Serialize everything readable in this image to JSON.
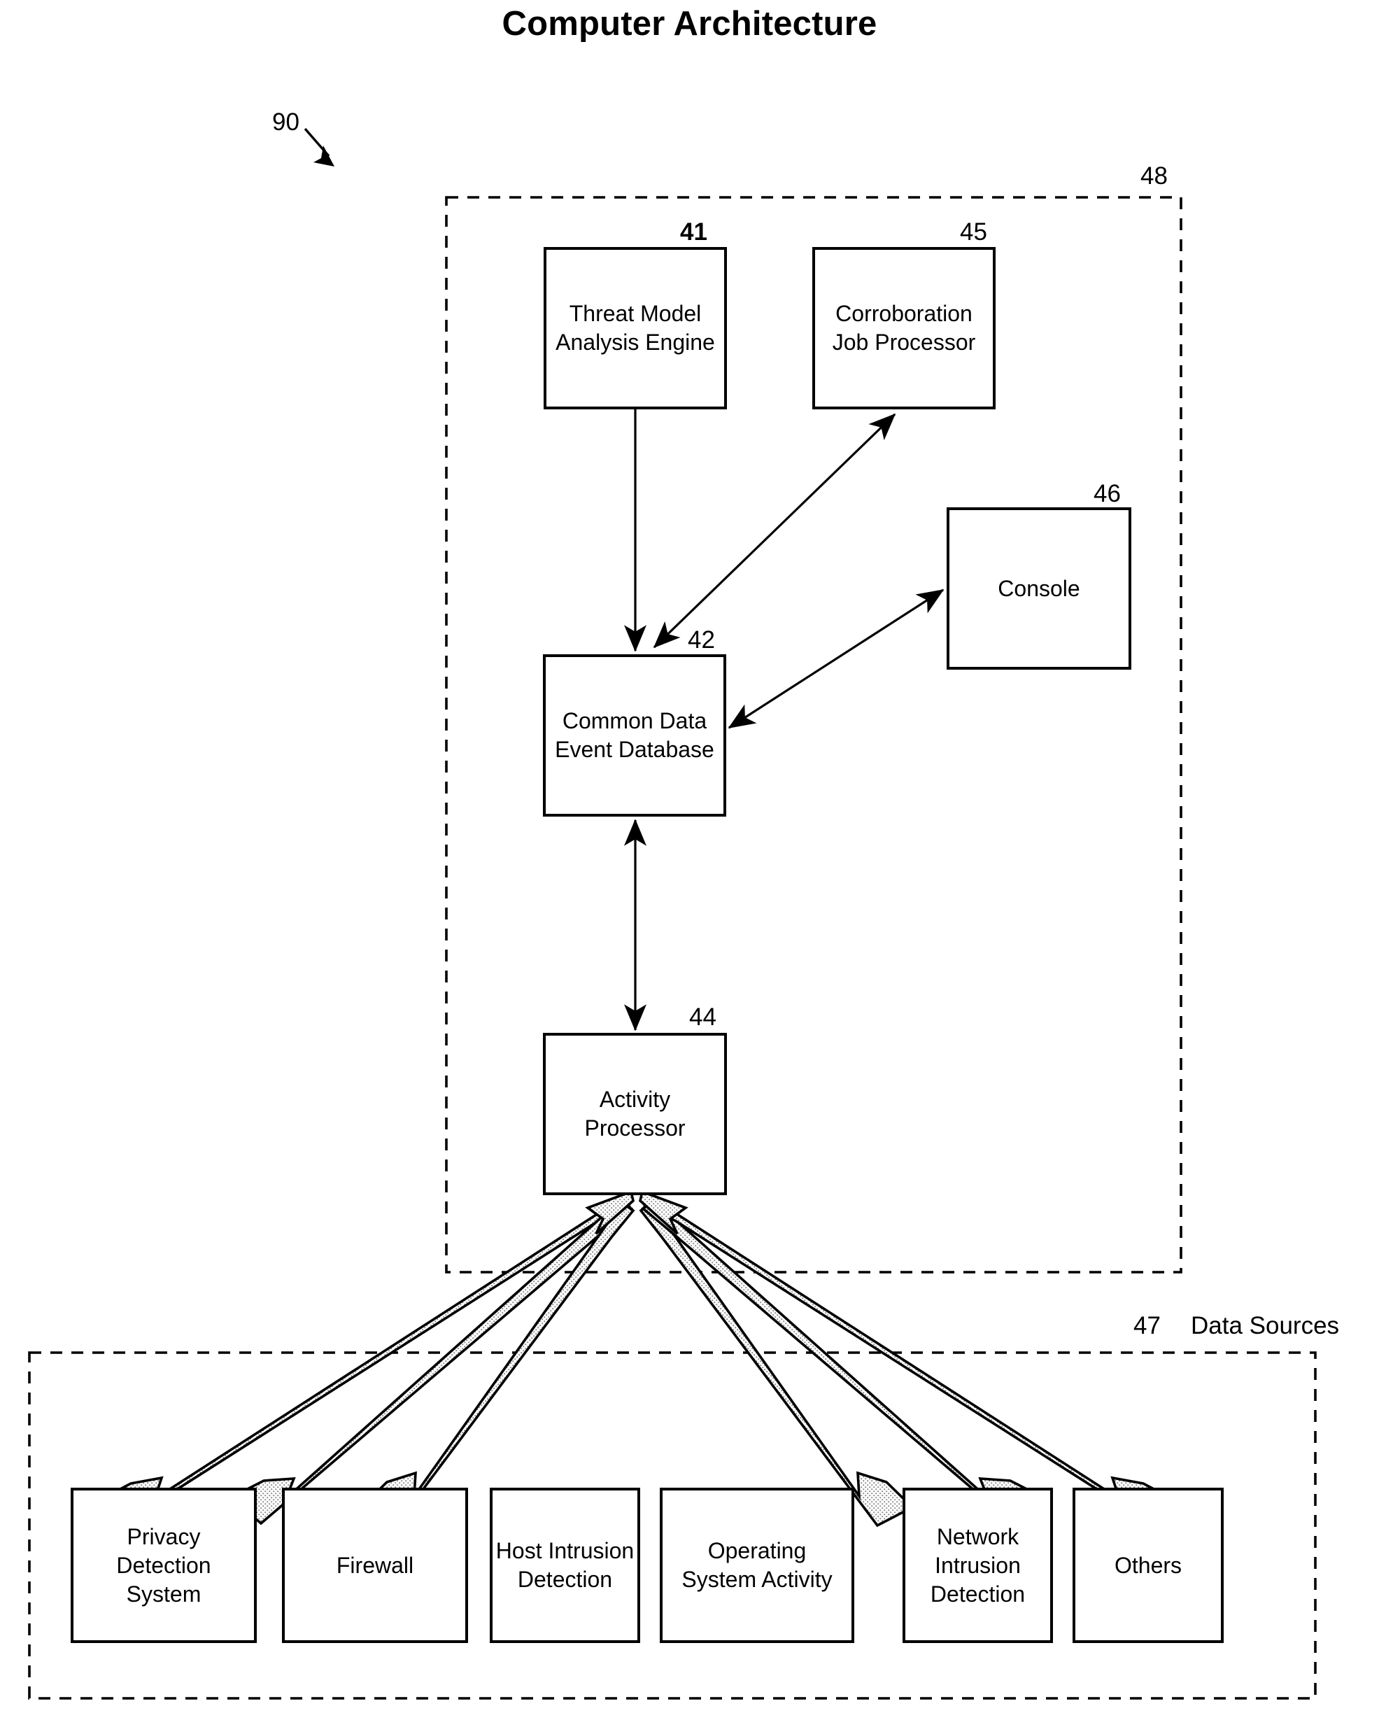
{
  "figure": {
    "title": "Computer Architecture",
    "figure_ref": "90"
  },
  "containers": [
    {
      "id": "system-container",
      "ref": "48",
      "label": "",
      "style": "dashed"
    },
    {
      "id": "data-sources-container",
      "ref": "47",
      "label": "Data Sources",
      "style": "dashed"
    }
  ],
  "system_boxes": [
    {
      "id": "threat-model-analysis-engine",
      "ref": "41",
      "ref_bold": true,
      "label": "Threat Model\nAnalysis Engine"
    },
    {
      "id": "corroboration-job-processor",
      "ref": "45",
      "ref_bold": false,
      "label": "Corroboration\nJob Processor"
    },
    {
      "id": "console",
      "ref": "46",
      "ref_bold": false,
      "label": "Console"
    },
    {
      "id": "common-data-event-database",
      "ref": "42",
      "ref_bold": false,
      "label": "Common Data\nEvent Database"
    },
    {
      "id": "activity-processor",
      "ref": "44",
      "ref_bold": false,
      "label": "Activity\nProcessor"
    }
  ],
  "data_source_boxes": [
    {
      "id": "privacy-detection-system",
      "label": "Privacy\nDetection\nSystem"
    },
    {
      "id": "firewall",
      "label": "Firewall"
    },
    {
      "id": "host-intrusion-detection",
      "label": "Host Intrusion\nDetection"
    },
    {
      "id": "operating-system-activity",
      "label": "Operating\nSystem Activity"
    },
    {
      "id": "network-intrusion-detection",
      "label": "Network\nIntrusion\nDetection"
    },
    {
      "id": "others",
      "label": "Others"
    }
  ],
  "colors": {
    "line": "#000000",
    "fill": "#ffffff",
    "arrow_fill": "#d8d8d8",
    "background": "#ffffff"
  }
}
